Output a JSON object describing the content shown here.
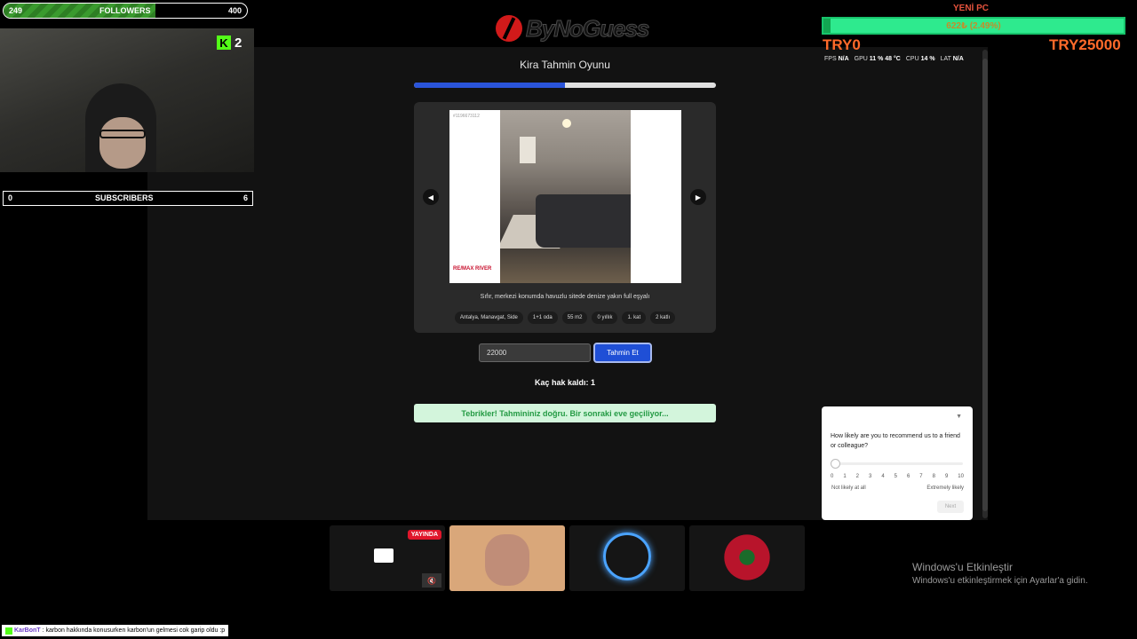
{
  "overlay": {
    "followers": {
      "current": "249",
      "label": "FOLLOWERS",
      "goal": "400",
      "progress": 0.6225
    },
    "kick_viewers": "2",
    "subscribers": {
      "current": "0",
      "label": "SUBSCRIBERS",
      "goal": "6"
    },
    "donation": {
      "title": "YENİ PC",
      "amount_text": "622₺ (2.49%)",
      "min": "TRY0",
      "max": "TRY25000",
      "progress": 0.0249
    },
    "stats": {
      "fps_label": "FPS",
      "fps": "N/A",
      "gpu_label": "GPU",
      "gpu": "11 % 48 °C",
      "cpu_label": "CPU",
      "cpu": "14 %",
      "lat_label": "LAT",
      "lat": "N/A"
    },
    "live_badge": "YAYINDA",
    "windows_activate": {
      "title": "Windows'u Etkinleştir",
      "subtitle": "Windows'u etkinleştirmek için Ayarlar'a gidin."
    },
    "chat": {
      "user": "KarBonT",
      "message": ": karbon hakkında konusurken karbon'un gelmesi cok garip oldu :p"
    }
  },
  "game": {
    "logo_text": "ByNoGuess",
    "title": "Kira Tahmin Oyunu",
    "progress": 0.5,
    "photo_id": "#1196673112",
    "photo_brand": "RE/MAX RIVER",
    "description": "Sıfır, merkezi konumda havuzlu sitede denize yakın full eşyalı",
    "tags": [
      "Antalya, Manavgat, Side",
      "1+1 oda",
      "55 m2",
      "0 yıllık",
      "1. kat",
      "2 katlı"
    ],
    "guess_value": "22000",
    "guess_button": "Tahmin Et",
    "tries_left": "Kaç hak kaldı: 1",
    "success_message": "Tebrikler! Tahmininiz doğru. Bir sonraki eve geçiliyor..."
  },
  "survey": {
    "question": "How likely are you to recommend us to a friend or colleague?",
    "scale": [
      "0",
      "1",
      "2",
      "3",
      "4",
      "5",
      "6",
      "7",
      "8",
      "9",
      "10"
    ],
    "low_label": "Not likely at all",
    "high_label": "Extremely likely",
    "next_label": "Next"
  }
}
